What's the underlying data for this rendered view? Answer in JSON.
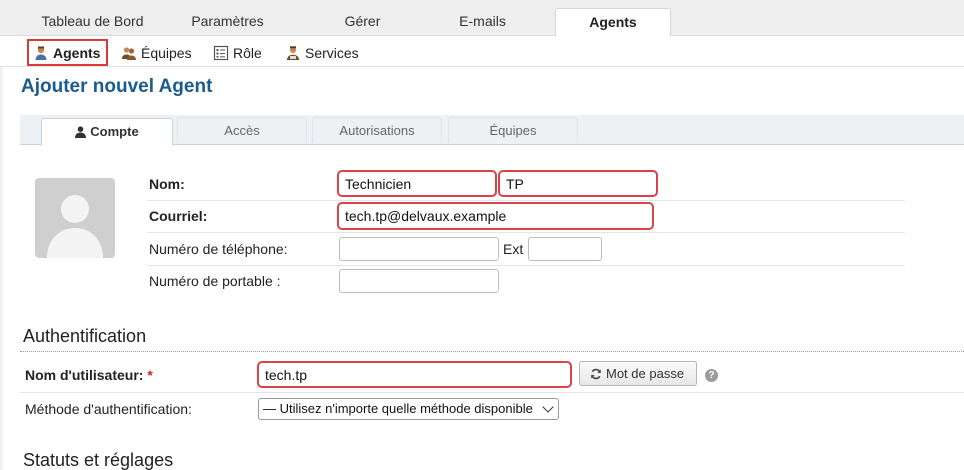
{
  "top_nav": {
    "tabs": [
      {
        "label": "Tableau de Bord"
      },
      {
        "label": "Paramètres"
      },
      {
        "label": "Gérer"
      },
      {
        "label": "E-mails"
      },
      {
        "label": "Agents",
        "active": true
      }
    ]
  },
  "sub_nav": {
    "items": [
      {
        "label": "Agents",
        "icon": "agent-icon",
        "active": true
      },
      {
        "label": "Équipes",
        "icon": "teams-icon"
      },
      {
        "label": "Rôle",
        "icon": "role-icon"
      },
      {
        "label": "Services",
        "icon": "services-icon"
      }
    ]
  },
  "page_title": "Ajouter nouvel Agent",
  "form_tabs": [
    {
      "label": "Compte",
      "icon": "user-icon",
      "active": true
    },
    {
      "label": "Accès"
    },
    {
      "label": "Autorisations"
    },
    {
      "label": "Équipes"
    }
  ],
  "account": {
    "name_label": "Nom:",
    "first_name": "Technicien",
    "last_name": "TP",
    "email_label": "Courriel:",
    "email": "tech.tp@delvaux.example",
    "phone_label": "Numéro de téléphone:",
    "phone": "",
    "ext_label": "Ext",
    "ext": "",
    "mobile_label": "Numéro de portable :",
    "mobile": ""
  },
  "auth": {
    "section_title": "Authentification",
    "username_label": "Nom d'utilisateur:",
    "required_mark": "*",
    "username": "tech.tp",
    "password_button": "Mot de passe",
    "help_icon": "?",
    "method_label": "Méthode d'authentification:",
    "method_selected": "— Utilisez n'importe quelle méthode disponible"
  },
  "status": {
    "section_title": "Statuts et réglages"
  },
  "colors": {
    "title_blue": "#1b5c8c",
    "highlight_red": "#d9444a"
  }
}
